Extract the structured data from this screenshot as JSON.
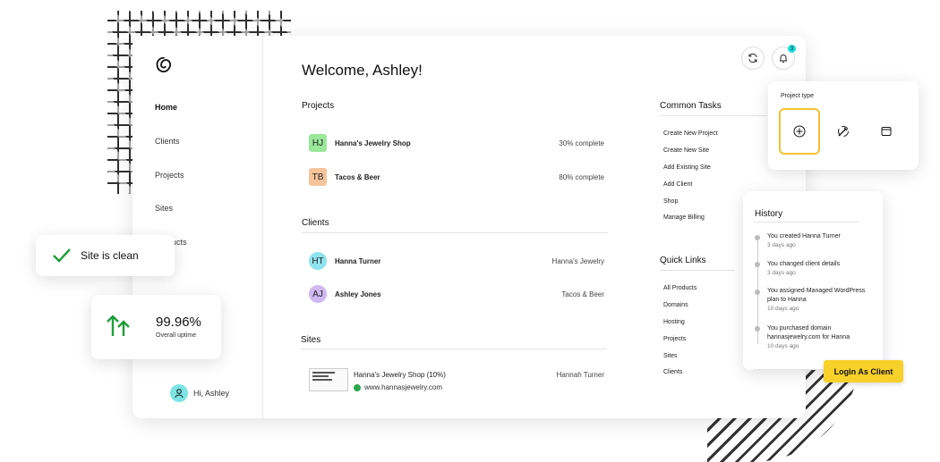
{
  "app": {
    "welcome": "Welcome, Ashley!"
  },
  "notifications": {
    "count": "3"
  },
  "sidebar": {
    "items": [
      {
        "label": "Home",
        "active": true
      },
      {
        "label": "Clients"
      },
      {
        "label": "Projects"
      },
      {
        "label": "Sites"
      },
      {
        "label": "Products"
      }
    ],
    "user_greeting": "Hi, Ashley"
  },
  "projects": {
    "title": "Projects",
    "rows": [
      {
        "initials": "HJ",
        "name": "Hanna's Jewelry Shop",
        "status": "30% complete",
        "color": "#9be89b"
      },
      {
        "initials": "TB",
        "name": "Tacos & Beer",
        "status": "80% complete",
        "color": "#f5c49a"
      }
    ]
  },
  "clients": {
    "title": "Clients",
    "rows": [
      {
        "initials": "HT",
        "name": "Hanna Turner",
        "company": "Hanna's Jewelry",
        "color": "#8fe3ee"
      },
      {
        "initials": "AJ",
        "name": "Ashley Jones",
        "company": "Tacos & Beer",
        "color": "#cfb8f2"
      }
    ]
  },
  "sites": {
    "title": "Sites",
    "rows": [
      {
        "name": "Hanna's Jewelry Shop (10%)",
        "url": "www.hannasjewelry.com",
        "owner": "Hannah Turner"
      }
    ]
  },
  "common_tasks": {
    "title": "Common Tasks",
    "items": [
      "Create New Project",
      "Create New Site",
      "Add Existing Site",
      "Add Client",
      "Shop",
      "Manage Billing"
    ]
  },
  "quick_links": {
    "title": "Quick Links",
    "items": [
      "All Products",
      "Domains",
      "Hosting",
      "Projects",
      "Sites",
      "Clients"
    ]
  },
  "status_card": {
    "label": "Site is clean"
  },
  "uptime_card": {
    "value": "99.96%",
    "label": "Overall uptime"
  },
  "project_type": {
    "title": "Project type"
  },
  "history": {
    "title": "History",
    "items": [
      {
        "text": "You created Hanna Turner",
        "time": "3 days ago"
      },
      {
        "text": "You changed client details",
        "time": "3 days ago"
      },
      {
        "text": "You assigned Managed WordPress plan to Hanna",
        "time": "10 days ago"
      },
      {
        "text": "You purchased domain hannasjewelry.com for Hanna",
        "time": "10 days ago"
      }
    ]
  },
  "login_button": {
    "label": "Login As Client"
  },
  "colors": {
    "accent": "#f7d02a",
    "check": "#1f9d3a",
    "badge": "#1bdbdb"
  }
}
